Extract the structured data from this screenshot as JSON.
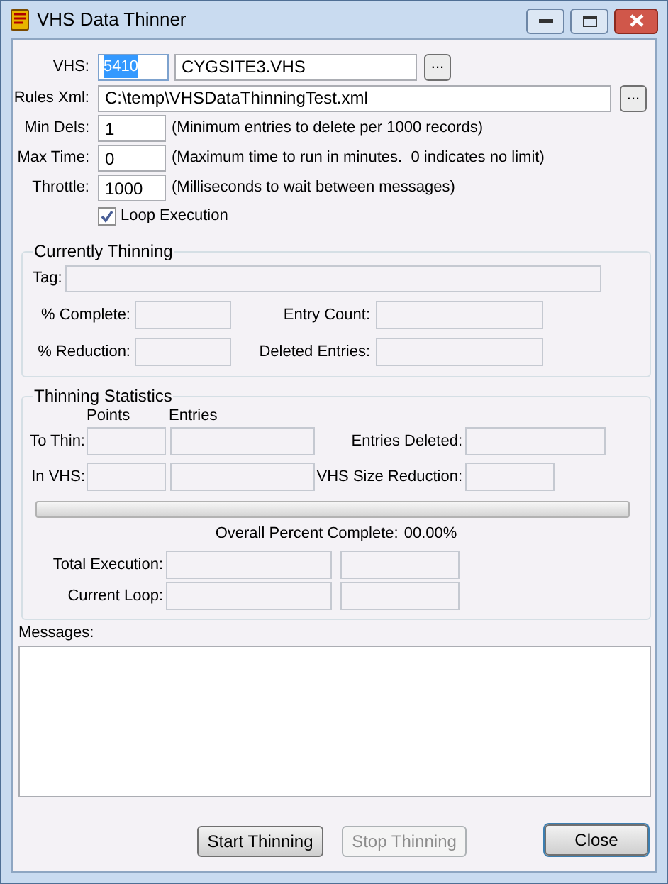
{
  "window": {
    "title": "VHS Data Thinner"
  },
  "settings": {
    "vhs": {
      "label": "VHS:",
      "number": "5410",
      "number_selected": true,
      "file": "CYGSITE3.VHS",
      "browse": "..."
    },
    "rules_xml": {
      "label": "Rules Xml:",
      "value": "C:\\temp\\VHSDataThinningTest.xml",
      "browse": "..."
    },
    "rows": [
      {
        "label": "Min Dels:",
        "value": "1",
        "note": "(Minimum entries to delete per 1000 records)"
      },
      {
        "label": "Max Time:",
        "value": "0",
        "note": "(Maximum time to run in minutes.  0 indicates no limit)"
      },
      {
        "label": "Throttle:",
        "value": "1000",
        "note": "(Milliseconds to wait between messages)"
      }
    ],
    "loop_execution": {
      "label": "Loop Execution",
      "checked": true
    }
  },
  "currently_thinning": {
    "title": "Currently Thinning",
    "tag_label": "Tag:",
    "fields": [
      {
        "label": "% Complete:"
      },
      {
        "label": "Entry Count:"
      },
      {
        "label": "% Reduction:"
      },
      {
        "label": "Deleted Entries:"
      }
    ]
  },
  "thinning_statistics": {
    "title": "Thinning Statistics",
    "column_headers": [
      "Points",
      "Entries"
    ],
    "rows": [
      {
        "label": "To Thin:",
        "right_label": "Entries Deleted:"
      },
      {
        "label": "In VHS:",
        "right_label": "VHS Size Reduction:"
      }
    ],
    "progress": {
      "level": 0
    },
    "overall_label": "Overall Percent Complete:",
    "overall_value": "00.00%",
    "timers": [
      {
        "label": "Total Execution:"
      },
      {
        "label": "Current Loop:"
      }
    ]
  },
  "messages": {
    "label": "Messages:"
  },
  "buttons": [
    {
      "label": "Start Thinning",
      "disabled": false,
      "default": false
    },
    {
      "label": "Stop Thinning",
      "disabled": true,
      "default": false
    },
    {
      "label": "Close",
      "disabled": false,
      "default": true
    }
  ]
}
